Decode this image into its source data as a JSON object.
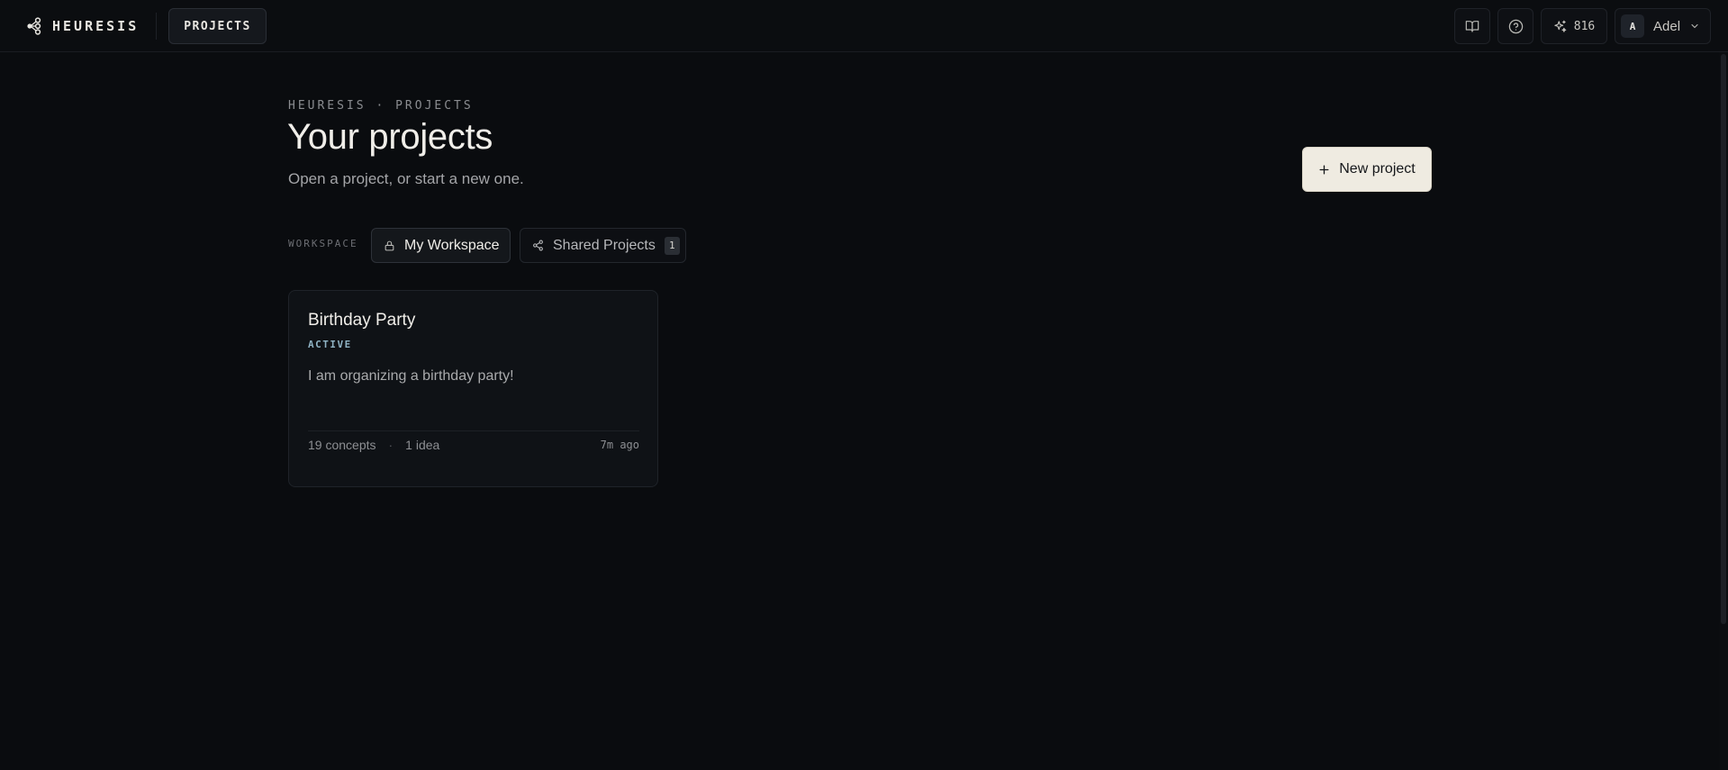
{
  "app": {
    "brand": "HEURESIS",
    "nav_projects": "PROJECTS",
    "credits": "816",
    "user": {
      "initial": "A",
      "name": "Adel"
    }
  },
  "icons": {
    "logo": "nodes-logo-icon",
    "docs": "book-open-icon",
    "help": "help-circle-icon",
    "credits": "sparkles-icon",
    "user_menu": "chevron-down-icon",
    "new_project": "plus-icon",
    "my_workspace": "lock-icon",
    "shared_projects": "share-icon"
  },
  "page": {
    "breadcrumb": "HEURESIS · PROJECTS",
    "title": "Your projects",
    "subtitle": "Open a project, or start a new one.",
    "new_project_label": "New project"
  },
  "workspace": {
    "label": "WORKSPACE",
    "tabs": [
      {
        "label": "My Workspace",
        "active": true
      },
      {
        "label": "Shared Projects",
        "count": "1",
        "active": false
      }
    ]
  },
  "projects": [
    {
      "title": "Birthday Party",
      "status": "ACTIVE",
      "description": "I am organizing a birthday party!",
      "concepts": "19 concepts",
      "ideas": "1 idea",
      "updated": "7m ago"
    }
  ],
  "colors": {
    "background": "#0a0c0f",
    "primary_button": "#efebe1",
    "status_active": "#8fb3c4"
  }
}
